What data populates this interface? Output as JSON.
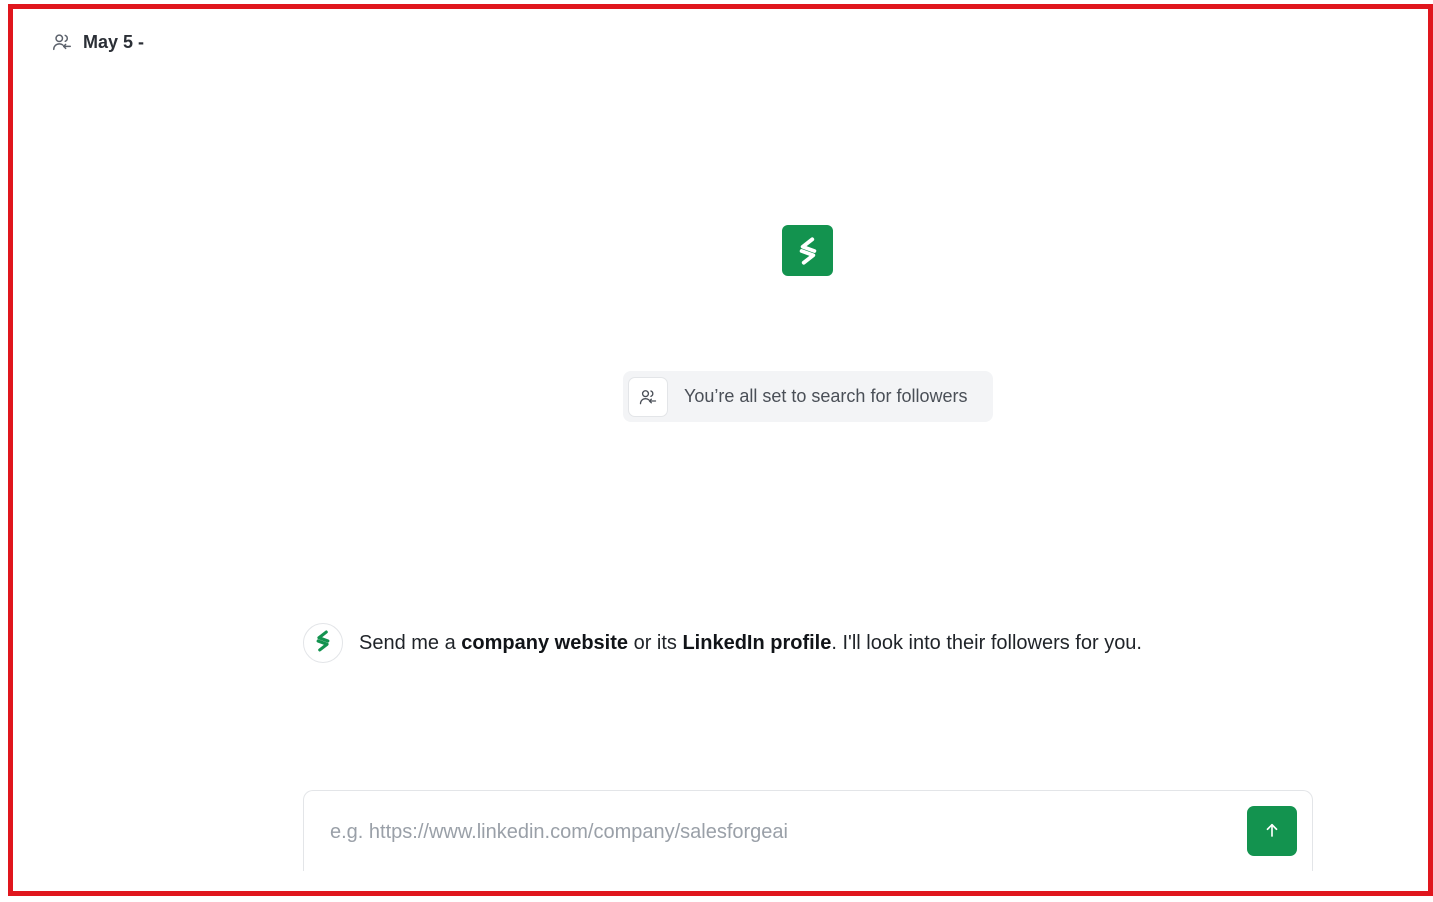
{
  "header": {
    "icon": "user-follow-icon",
    "title": "May 5 -"
  },
  "hero": {
    "logo_icon": "salesforge-logo-icon",
    "brand_color": "#13934f"
  },
  "status": {
    "icon": "user-follow-icon",
    "text": "You’re all set to search for followers"
  },
  "message": {
    "avatar_icon": "salesforge-logo-icon",
    "part1": "Send me a ",
    "bold1": "company website",
    "part2": " or its ",
    "bold2": "LinkedIn profile",
    "part3": ". I'll look into their followers for you."
  },
  "composer": {
    "value": "",
    "placeholder": "e.g. https://www.linkedin.com/company/salesforgeai",
    "send_icon": "arrow-up-icon"
  },
  "colors": {
    "frame_border": "#e0161d",
    "accent": "#13934f"
  }
}
